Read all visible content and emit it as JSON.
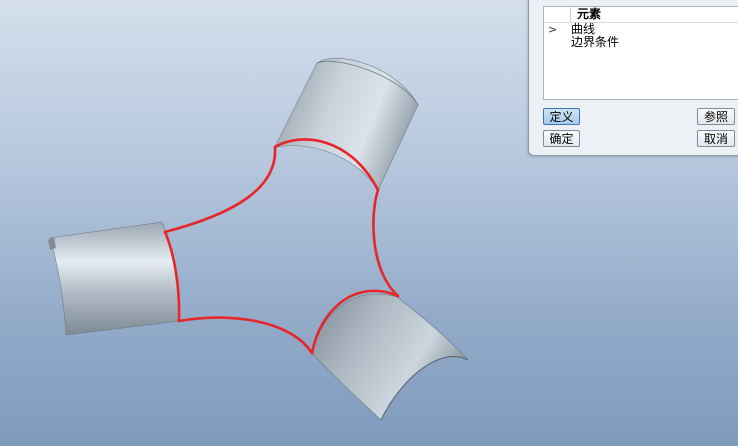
{
  "panel": {
    "table_header": "元素",
    "rows": [
      {
        "expander": ">",
        "label": "曲线"
      },
      {
        "expander": "",
        "label": "边界条件"
      }
    ],
    "buttons": {
      "define": "定义",
      "reference": "参照",
      "ok": "确定",
      "cancel": "取消"
    }
  },
  "colors": {
    "curve_highlight": "#e8262a",
    "surface": "#aab6c2",
    "viewport_top": "#d5dfec",
    "viewport_bottom": "#7f9abd"
  }
}
